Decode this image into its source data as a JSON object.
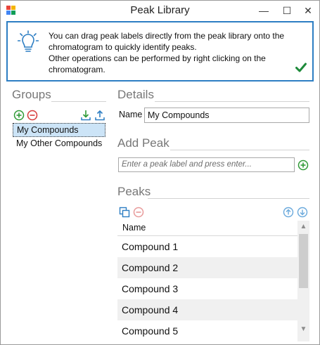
{
  "window": {
    "title": "Peak Library",
    "minimize": "—",
    "maximize": "☐",
    "close": "✕"
  },
  "banner": {
    "line1": "You can drag peak labels directly from the peak library onto the chromatogram to quickly identify peaks.",
    "line2": "Other operations can be performed by right clicking on the chromatogram."
  },
  "groups": {
    "heading": "Groups",
    "items": [
      "My Compounds",
      "My Other Compounds"
    ],
    "selected_index": 0
  },
  "details": {
    "heading": "Details",
    "name_label": "Name",
    "name_value": "My Compounds"
  },
  "add_peak": {
    "heading": "Add Peak",
    "placeholder": "Enter a peak label and press enter..."
  },
  "peaks": {
    "heading": "Peaks",
    "column_header": "Name",
    "rows": [
      "Compound  1",
      "Compound  2",
      "Compound  3",
      "Compound  4",
      "Compound  5"
    ]
  },
  "colors": {
    "accent_blue": "#2d7ec3",
    "add_green": "#2e9a35",
    "remove_red": "#d83b3b",
    "check_green": "#1e8a3a"
  }
}
